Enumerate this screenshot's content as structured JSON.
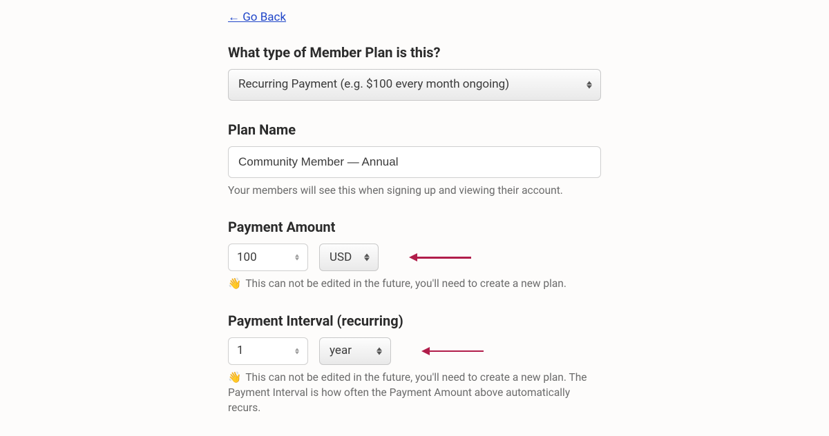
{
  "nav": {
    "go_back": "← Go Back"
  },
  "plan_type": {
    "heading": "What type of Member Plan is this?",
    "selected": "Recurring Payment (e.g. $100 every month ongoing)"
  },
  "plan_name": {
    "heading": "Plan Name",
    "value": "Community Member — Annual",
    "help": "Your members will see this when signing up and viewing their account."
  },
  "payment_amount": {
    "heading": "Payment Amount",
    "value": "100",
    "currency": "USD",
    "help_emoji": "👋",
    "help": "This can not be edited in the future, you'll need to create a new plan."
  },
  "payment_interval": {
    "heading": "Payment Interval (recurring)",
    "value": "1",
    "unit": "year",
    "help_emoji": "👋",
    "help": "This can not be edited in the future, you'll need to create a new plan. The Payment Interval is how often the Payment Amount above automatically recurs."
  }
}
